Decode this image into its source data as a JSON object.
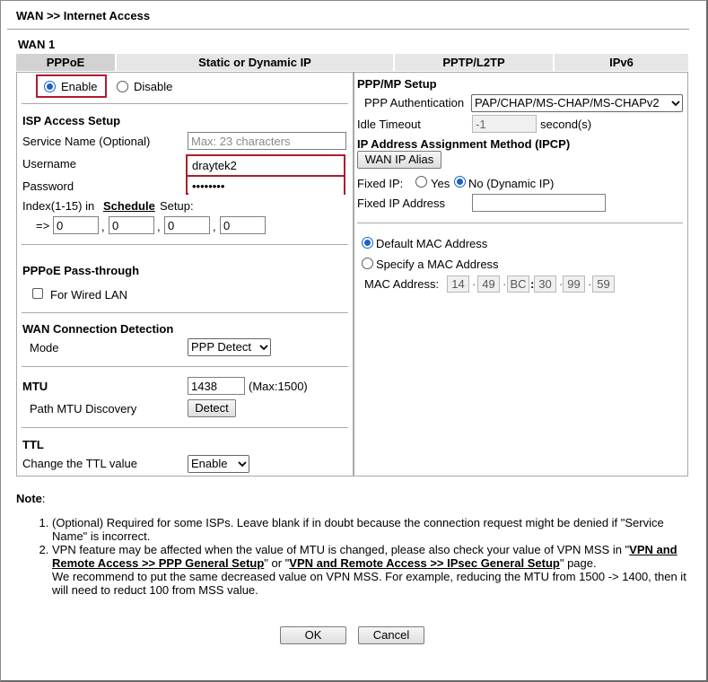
{
  "page": {
    "title": "WAN >> Internet Access",
    "section": "WAN 1"
  },
  "tabs": [
    {
      "label": "PPPoE",
      "active": true
    },
    {
      "label": "Static or Dynamic IP",
      "active": false
    },
    {
      "label": "PPTP/L2TP",
      "active": false
    },
    {
      "label": "IPv6",
      "active": false
    }
  ],
  "left": {
    "enable_label": "Enable",
    "disable_label": "Disable",
    "isp_heading": "ISP Access Setup",
    "service_name_label": "Service Name (Optional)",
    "service_name_placeholder": "Max: 23 characters",
    "username_label": "Username",
    "username_value": "draytek2",
    "password_label": "Password",
    "password_value": "••••••••",
    "index_prefix": "Index(1-15) in",
    "schedule_link": "Schedule",
    "index_suffix": "Setup:",
    "arrow": "=>",
    "schedule_values": [
      "0",
      "0",
      "0",
      "0"
    ],
    "comma": ",",
    "passthrough_heading": "PPPoE Pass-through",
    "wired_lan_label": "For Wired LAN",
    "detection_heading": "WAN Connection Detection",
    "mode_label": "Mode",
    "mode_value": "PPP Detect",
    "mtu_heading": "MTU",
    "mtu_value": "1438",
    "mtu_max": "(Max:1500)",
    "path_mtu_label": "Path MTU Discovery",
    "detect_button": "Detect",
    "ttl_heading": "TTL",
    "ttl_label": "Change the TTL value",
    "ttl_value": "Enable"
  },
  "right": {
    "ppp_heading": "PPP/MP Setup",
    "auth_label": "PPP Authentication",
    "auth_value": "PAP/CHAP/MS-CHAP/MS-CHAPv2",
    "idle_label": "Idle Timeout",
    "idle_value": "-1",
    "idle_unit": "second(s)",
    "ip_heading": "IP Address Assignment Method (IPCP)",
    "alias_button": "WAN IP Alias",
    "fixed_ip_label": "Fixed IP:",
    "yes_label": "Yes",
    "no_label": "No (Dynamic IP)",
    "fixed_addr_label": "Fixed IP Address",
    "fixed_addr_value": "",
    "default_mac_label": "Default MAC Address",
    "specify_mac_label": "Specify a MAC Address",
    "mac_label": "MAC Address:",
    "mac_octets": [
      "14",
      "49",
      "BC",
      "30",
      "99",
      "59"
    ],
    "mac_seps": [
      "·",
      "·",
      ":",
      "·",
      "·"
    ]
  },
  "note": {
    "title": "Note",
    "colon": ":",
    "item1": "(Optional) Required for some ISPs. Leave blank if in doubt because the connection request might be denied if \"Service Name\" is incorrect.",
    "item2_a": "VPN feature may be affected when the value of MTU is changed, please also check your value of VPN MSS in \"",
    "item2_link1": "VPN and Remote Access >> PPP General Setup",
    "item2_b": "\" or \"",
    "item2_link2": "VPN and Remote Access >> IPsec General Setup",
    "item2_c": "\" page.",
    "item2_d": "We recommend to put the same decreased value on VPN MSS. For example, reducing the MTU from 1500 -> 1400, then it will need to reduct 100 from MSS value."
  },
  "buttons": {
    "ok": "OK",
    "cancel": "Cancel"
  },
  "colors": {
    "highlight": "#b01c2e",
    "radio_on": "#1a62c8",
    "tab_bg": "#e6e6e6"
  }
}
